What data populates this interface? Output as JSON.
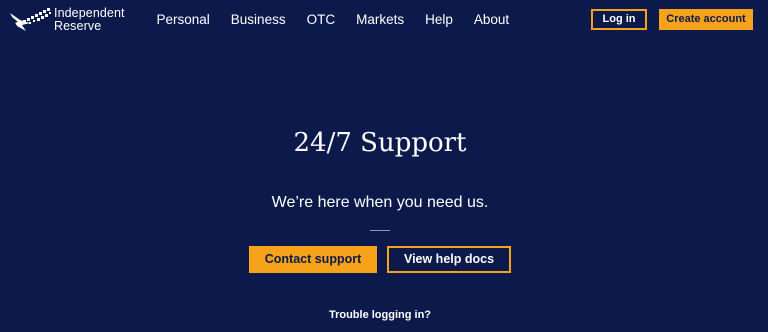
{
  "brand": {
    "line1": "Independent",
    "line2": "Reserve",
    "logo_icon": "wing-logo-icon"
  },
  "nav": {
    "items": [
      {
        "label": "Personal"
      },
      {
        "label": "Business"
      },
      {
        "label": "OTC"
      },
      {
        "label": "Markets"
      },
      {
        "label": "Help"
      },
      {
        "label": "About"
      }
    ]
  },
  "header": {
    "login_label": "Log in",
    "create_label": "Create account"
  },
  "hero": {
    "title": "24/7 Support",
    "subtitle": "We’re here when you need us.",
    "contact_label": "Contact support",
    "docs_label": "View help docs",
    "trouble_label": "Trouble logging in?"
  },
  "colors": {
    "background": "#0c1a4b",
    "accent": "#f6a21a",
    "text": "#ffffff"
  }
}
